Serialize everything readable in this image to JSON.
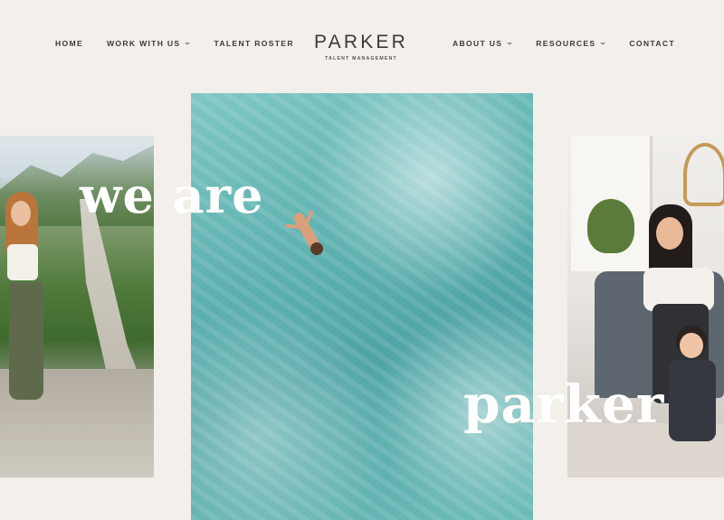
{
  "nav": {
    "left": [
      {
        "label": "HOME",
        "dropdown": false
      },
      {
        "label": "WORK WITH US",
        "dropdown": true
      },
      {
        "label": "TALENT ROSTER",
        "dropdown": false
      }
    ],
    "right": [
      {
        "label": "ABOUT US",
        "dropdown": true
      },
      {
        "label": "RESOURCES",
        "dropdown": true
      },
      {
        "label": "CONTACT",
        "dropdown": false
      }
    ]
  },
  "logo": {
    "wordmark": "PARKER",
    "tagline": "TALENT MANAGEMENT"
  },
  "hero": {
    "headline_top": "we are",
    "headline_bottom": "parker"
  },
  "colors": {
    "background": "#f3efea",
    "text": "#3a3a3a",
    "headline": "#ffffff"
  }
}
